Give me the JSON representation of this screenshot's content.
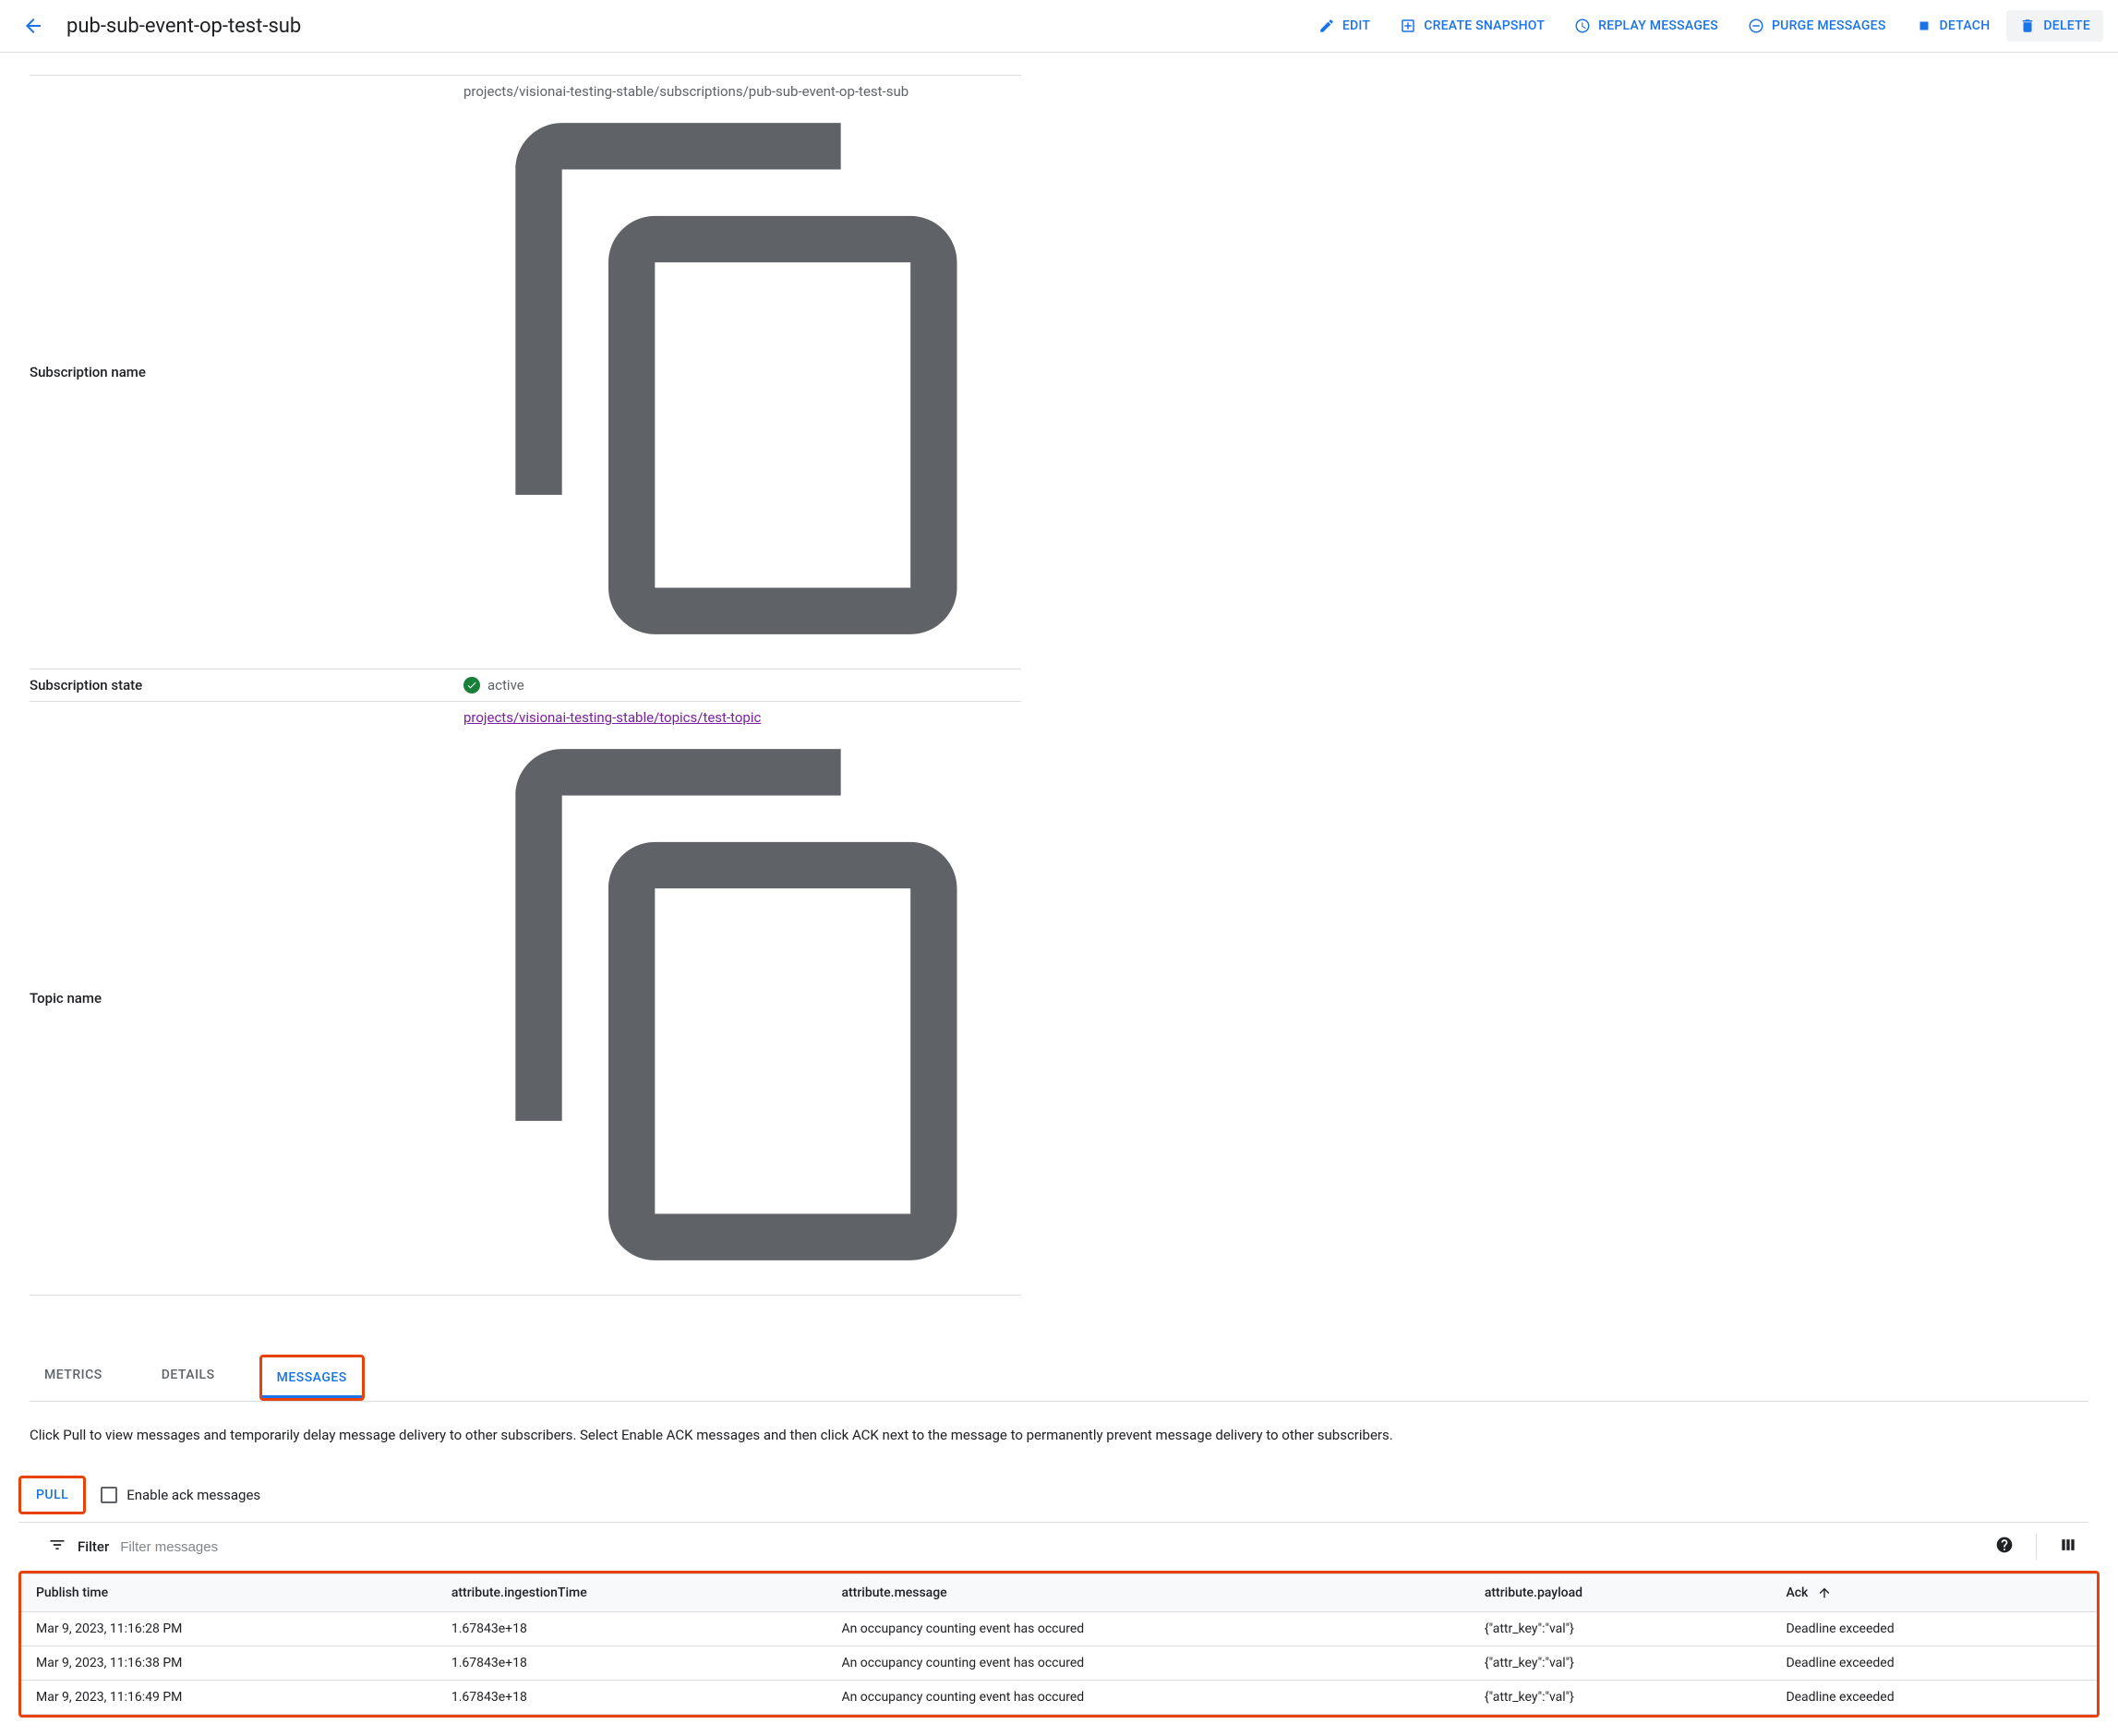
{
  "header": {
    "title": "pub-sub-event-op-test-sub",
    "actions": {
      "edit": "EDIT",
      "snapshot": "CREATE SNAPSHOT",
      "replay": "REPLAY MESSAGES",
      "purge": "PURGE MESSAGES",
      "detach": "DETACH",
      "delete": "DELETE"
    }
  },
  "details": {
    "sub_name_label": "Subscription name",
    "sub_name_value": "projects/visionai-testing-stable/subscriptions/pub-sub-event-op-test-sub",
    "sub_state_label": "Subscription state",
    "sub_state_value": "active",
    "topic_label": "Topic name",
    "topic_value": "projects/visionai-testing-stable/topics/test-topic"
  },
  "tabs": {
    "metrics": "METRICS",
    "details": "DETAILS",
    "messages": "MESSAGES"
  },
  "messages_panel": {
    "help": "Click Pull to view messages and temporarily delay message delivery to other subscribers. Select Enable ACK messages and then click ACK next to the message to permanently prevent message delivery to other subscribers.",
    "pull": "PULL",
    "enable_ack": "Enable ack messages",
    "filter_label": "Filter",
    "filter_placeholder": "Filter messages"
  },
  "table": {
    "headers": {
      "publish_time": "Publish time",
      "ingestion": "attribute.ingestionTime",
      "message": "attribute.message",
      "payload": "attribute.payload",
      "ack": "Ack"
    },
    "rows": [
      {
        "publish_time": "Mar 9, 2023, 11:16:28 PM",
        "ingestion": "1.67843e+18",
        "message": "An occupancy counting event has occured",
        "payload": "{\"attr_key\":\"val\"}",
        "ack": "Deadline exceeded"
      },
      {
        "publish_time": "Mar 9, 2023, 11:16:38 PM",
        "ingestion": "1.67843e+18",
        "message": "An occupancy counting event has occured",
        "payload": "{\"attr_key\":\"val\"}",
        "ack": "Deadline exceeded"
      },
      {
        "publish_time": "Mar 9, 2023, 11:16:49 PM",
        "ingestion": "1.67843e+18",
        "message": "An occupancy counting event has occured",
        "payload": "{\"attr_key\":\"val\"}",
        "ack": "Deadline exceeded"
      }
    ]
  }
}
